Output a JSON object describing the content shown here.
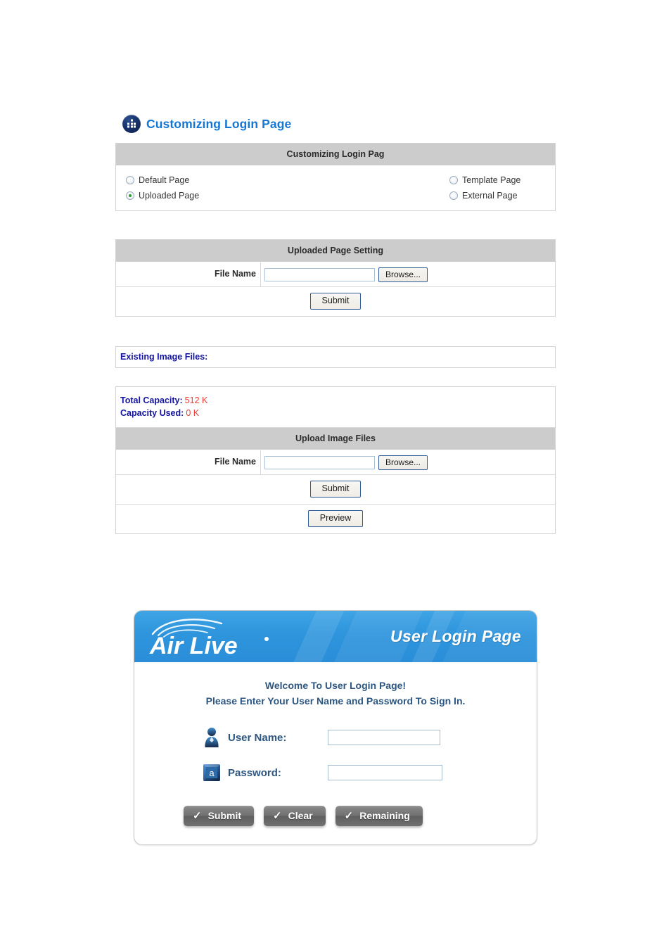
{
  "page": {
    "title": "Customizing Login Page",
    "title_icon": "grid-icon"
  },
  "customizing_panel": {
    "header": "Customizing Login Pag",
    "options": [
      {
        "label": "Default Page",
        "selected": false
      },
      {
        "label": "Template Page",
        "selected": false
      },
      {
        "label": "Uploaded Page",
        "selected": true
      },
      {
        "label": "External Page",
        "selected": false
      }
    ]
  },
  "uploaded_page_setting": {
    "header": "Uploaded Page Setting",
    "file_name_label": "File Name",
    "file_name_value": "",
    "file_name_placeholder": "",
    "browse_label": "Browse...",
    "submit_label": "Submit"
  },
  "existing_image_files": {
    "header": "Existing Image Files:"
  },
  "capacity": {
    "total_label": "Total Capacity:",
    "total_value": "512 K",
    "used_label": "Capacity Used:",
    "used_value": "0 K"
  },
  "upload_image_files": {
    "header": "Upload Image Files",
    "file_name_label": "File Name",
    "file_name_value": "",
    "file_name_placeholder": "",
    "browse_label": "Browse...",
    "submit_label": "Submit",
    "preview_label": "Preview"
  },
  "login_preview": {
    "brand": "Air Live",
    "brand_mark": "·",
    "banner_title": "User Login Page",
    "welcome_line1": "Welcome To User Login Page!",
    "welcome_line2": "Please Enter Your User Name and Password To Sign In.",
    "username_label": "User Name:",
    "username_value": "",
    "username_icon": "user-silhouette-icon",
    "password_label": "Password:",
    "password_value": "",
    "password_icon": "password-key-icon",
    "buttons": [
      {
        "label": "Submit",
        "icon": "check-icon"
      },
      {
        "label": "Clear",
        "icon": "check-icon"
      },
      {
        "label": "Remaining",
        "icon": "check-icon"
      }
    ]
  },
  "colors": {
    "title_blue": "#1577d4",
    "header_gray": "#cccccc",
    "label_navy": "#1414a0",
    "value_red": "#ee3b33",
    "banner_blue": "#2e95dd",
    "login_text_blue": "#2d5680",
    "radio_green": "#2e9c2e"
  }
}
